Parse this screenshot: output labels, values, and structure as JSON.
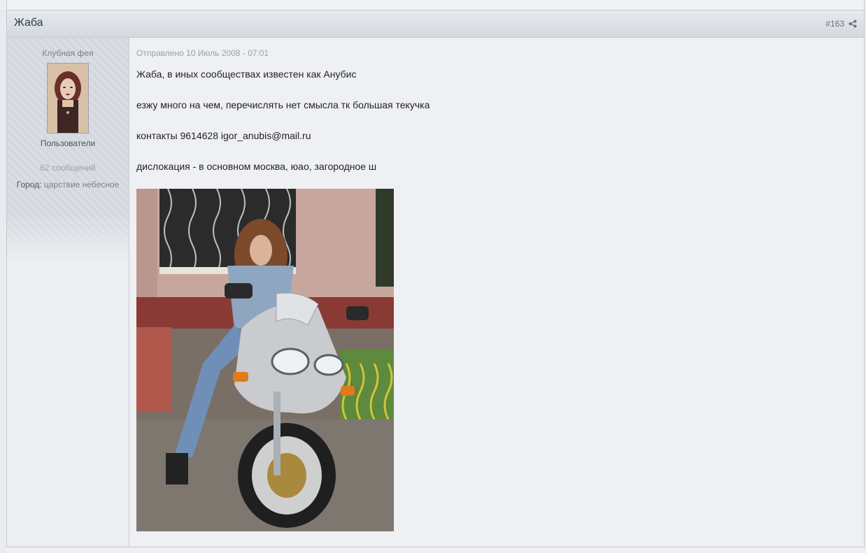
{
  "post": {
    "author_name": "Жаба",
    "number": "#163"
  },
  "sidebar": {
    "user_title": "Клубная фея",
    "group": "Пользователи",
    "post_count": "62 сообщений",
    "city_label": "Город:",
    "city_value": "царствие небесное"
  },
  "content": {
    "date": "Отправлено 10 Июль 2008 - 07:01",
    "lines": [
      "Жаба, в иных сообществах известен как Анубис",
      "езжу много на чем, перечислять нет смысла тк большая текучка",
      "контакты 9614628 igor_anubis@mail.ru",
      "дислокация - в основном москва, юао, загородное ш"
    ]
  },
  "icons": {
    "share": "share-icon",
    "avatar": "avatar-image",
    "photo": "motorcycle-photo"
  }
}
